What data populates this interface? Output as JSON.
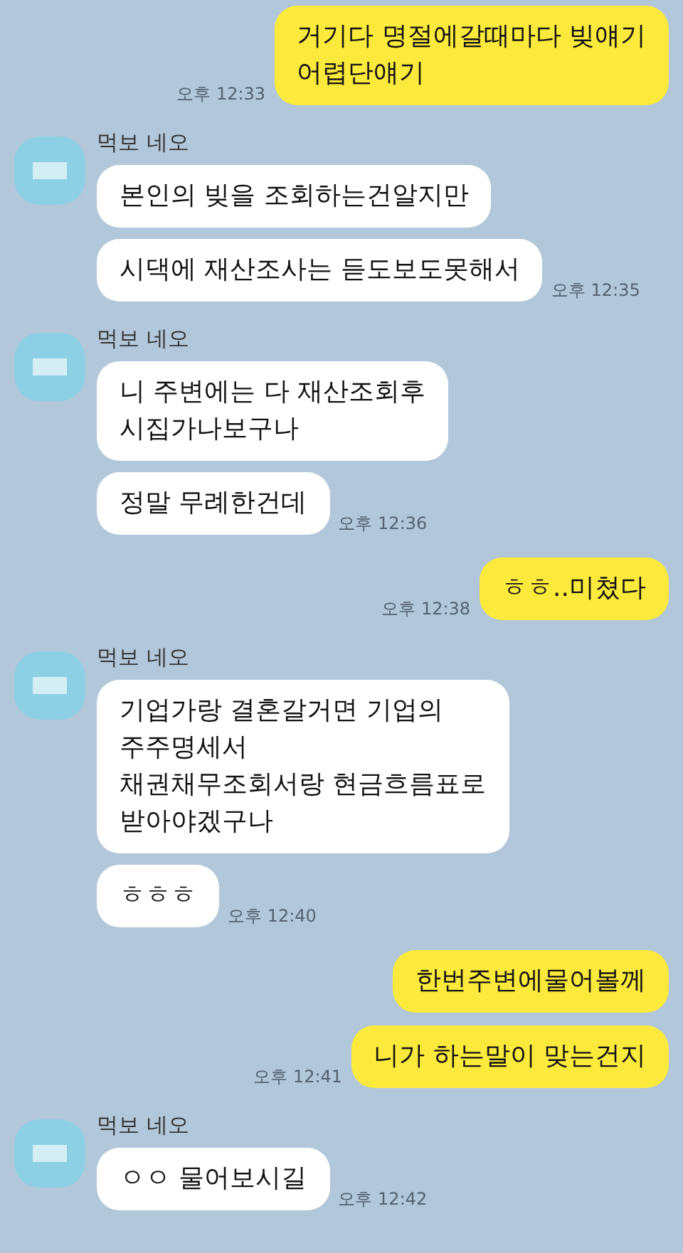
{
  "groups": [
    {
      "kind": "sent",
      "messages": [
        {
          "text": "거기다 명절에갈때마다 빚얘기\n어렵단얘기",
          "time": "오후 12:33"
        }
      ]
    },
    {
      "kind": "received",
      "sender": "먹보 네오",
      "messages": [
        {
          "text": "본인의 빚을 조회하는건알지만"
        },
        {
          "text": "시댁에 재산조사는 듣도보도못해서",
          "time": "오후 12:35"
        }
      ]
    },
    {
      "kind": "received",
      "sender": "먹보 네오",
      "messages": [
        {
          "text": "니 주변에는 다 재산조회후\n시집가나보구나"
        },
        {
          "text": "정말 무례한건데",
          "time": "오후 12:36"
        }
      ]
    },
    {
      "kind": "sent",
      "messages": [
        {
          "text": "ㅎㅎ..미쳤다",
          "time": "오후 12:38"
        }
      ]
    },
    {
      "kind": "received",
      "sender": "먹보 네오",
      "messages": [
        {
          "text": "기업가랑 결혼갈거면 기업의\n주주명세서\n채권채무조회서랑 현금흐름표로\n받아야겠구나"
        },
        {
          "text": "ㅎㅎㅎ",
          "time": "오후 12:40"
        }
      ]
    },
    {
      "kind": "sent",
      "messages": [
        {
          "text": "한번주변에물어볼께"
        },
        {
          "text": "니가 하는말이 맞는건지",
          "time": "오후 12:41"
        }
      ]
    },
    {
      "kind": "received",
      "sender": "먹보 네오",
      "messages": [
        {
          "text": "ㅇㅇ 물어보시길",
          "time": "오후 12:42"
        }
      ]
    }
  ]
}
